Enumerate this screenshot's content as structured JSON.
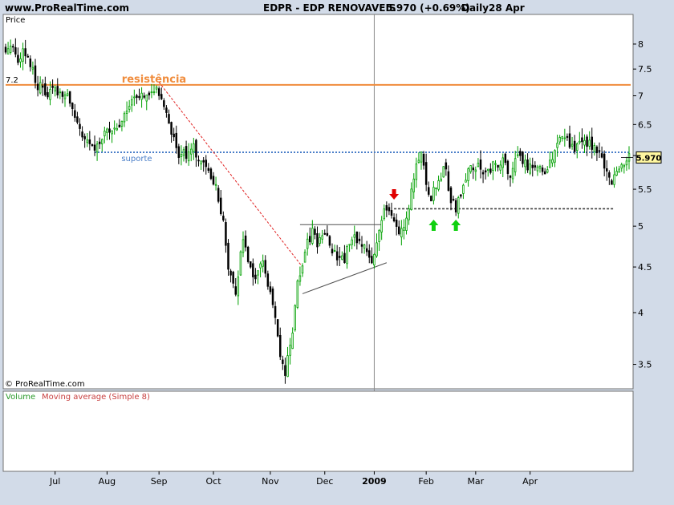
{
  "header": {
    "site": "www.ProRealTime.com",
    "instrument": "EDPR - EDP RENOVAVEIS",
    "quote": "5.970 (+0.69%)",
    "period": "Daily",
    "date": "28 Apr"
  },
  "price_panel": {
    "label": "Price",
    "copyright": "© ProRealTime.com"
  },
  "volume_panel": {
    "label_volume": "Volume",
    "label_ma": "Moving average (Simple 8)"
  },
  "annotations": {
    "resistance_label": "resistência",
    "resistance_value_label": "7.2",
    "support_label": "suporte",
    "last_price_label": "5.970"
  },
  "colors": {
    "bullish": "#00a000",
    "bearish": "#000000",
    "resistance": "#f08c3c",
    "support": "#4a7ec8",
    "downtrend": "#e02020",
    "arrow_down": "#e00000",
    "arrow_up": "#10d010",
    "volume_text": "#2a9a2a",
    "ma_text": "#c84040"
  },
  "chart_data": {
    "type": "candlestick",
    "scale": "log",
    "ylim": [
      3.3,
      8.6
    ],
    "y_ticks": [
      "3.5",
      "4",
      "4.5",
      "5",
      "5.5",
      "6",
      "6.5",
      "7",
      "7.5",
      "8"
    ],
    "x_ticks": [
      "Jul",
      "Aug",
      "Sep",
      "Oct",
      "Nov",
      "Dec",
      "2009",
      "Feb",
      "Mar",
      "Apr"
    ],
    "levels": {
      "resistance": 7.2,
      "support": 6.05,
      "neckline": 5.23,
      "last_price": 5.97
    },
    "price_path": [
      [
        0,
        7.95
      ],
      [
        2,
        8.0
      ],
      [
        5,
        7.7
      ],
      [
        8,
        7.85
      ],
      [
        10,
        7.6
      ],
      [
        13,
        7.2
      ],
      [
        16,
        7.1
      ],
      [
        19,
        7.05
      ],
      [
        22,
        7.1
      ],
      [
        25,
        6.95
      ],
      [
        28,
        6.65
      ],
      [
        30,
        6.35
      ],
      [
        33,
        6.3
      ],
      [
        35,
        6.1
      ],
      [
        38,
        6.25
      ],
      [
        41,
        6.35
      ],
      [
        44,
        6.4
      ],
      [
        47,
        6.6
      ],
      [
        49,
        6.8
      ],
      [
        52,
        7.0
      ],
      [
        55,
        7.05
      ],
      [
        58,
        7.1
      ],
      [
        60,
        7.15
      ],
      [
        62,
        7.0
      ],
      [
        65,
        6.7
      ],
      [
        67,
        6.3
      ],
      [
        70,
        6.05
      ],
      [
        73,
        6.0
      ],
      [
        76,
        6.1
      ],
      [
        79,
        5.85
      ],
      [
        82,
        5.75
      ],
      [
        85,
        5.5
      ],
      [
        88,
        5.1
      ],
      [
        90,
        4.5
      ],
      [
        93,
        4.15
      ],
      [
        96,
        4.85
      ],
      [
        99,
        4.5
      ],
      [
        101,
        4.3
      ],
      [
        104,
        4.6
      ],
      [
        106,
        4.3
      ],
      [
        108,
        4.1
      ],
      [
        111,
        3.55
      ],
      [
        113,
        3.42
      ],
      [
        116,
        3.75
      ],
      [
        118,
        4.3
      ],
      [
        121,
        4.7
      ],
      [
        124,
        4.9
      ],
      [
        126,
        4.8
      ],
      [
        129,
        4.95
      ],
      [
        132,
        4.7
      ],
      [
        135,
        4.55
      ],
      [
        137,
        4.6
      ],
      [
        140,
        4.85
      ],
      [
        143,
        4.8
      ],
      [
        145,
        4.7
      ],
      [
        148,
        4.6
      ],
      [
        151,
        4.95
      ],
      [
        153,
        5.2
      ],
      [
        156,
        5.15
      ],
      [
        159,
        4.95
      ],
      [
        162,
        5.1
      ],
      [
        164,
        5.5
      ],
      [
        166,
        5.9
      ],
      [
        168,
        6.0
      ],
      [
        170,
        5.6
      ],
      [
        172,
        5.4
      ],
      [
        175,
        5.55
      ],
      [
        177,
        5.9
      ],
      [
        180,
        5.35
      ],
      [
        182,
        5.25
      ],
      [
        184,
        5.45
      ],
      [
        186,
        5.7
      ],
      [
        189,
        5.85
      ],
      [
        192,
        5.8
      ],
      [
        195,
        5.75
      ],
      [
        198,
        5.85
      ],
      [
        201,
        5.9
      ],
      [
        204,
        5.75
      ],
      [
        207,
        5.95
      ],
      [
        210,
        5.85
      ],
      [
        213,
        5.9
      ],
      [
        216,
        5.8
      ],
      [
        219,
        5.75
      ],
      [
        222,
        6.05
      ],
      [
        225,
        6.35
      ],
      [
        228,
        6.2
      ],
      [
        231,
        6.1
      ],
      [
        234,
        6.25
      ],
      [
        237,
        6.15
      ],
      [
        240,
        6.0
      ],
      [
        243,
        5.8
      ],
      [
        245,
        5.55
      ],
      [
        248,
        5.8
      ],
      [
        250,
        5.9
      ],
      [
        252,
        5.97
      ]
    ]
  }
}
